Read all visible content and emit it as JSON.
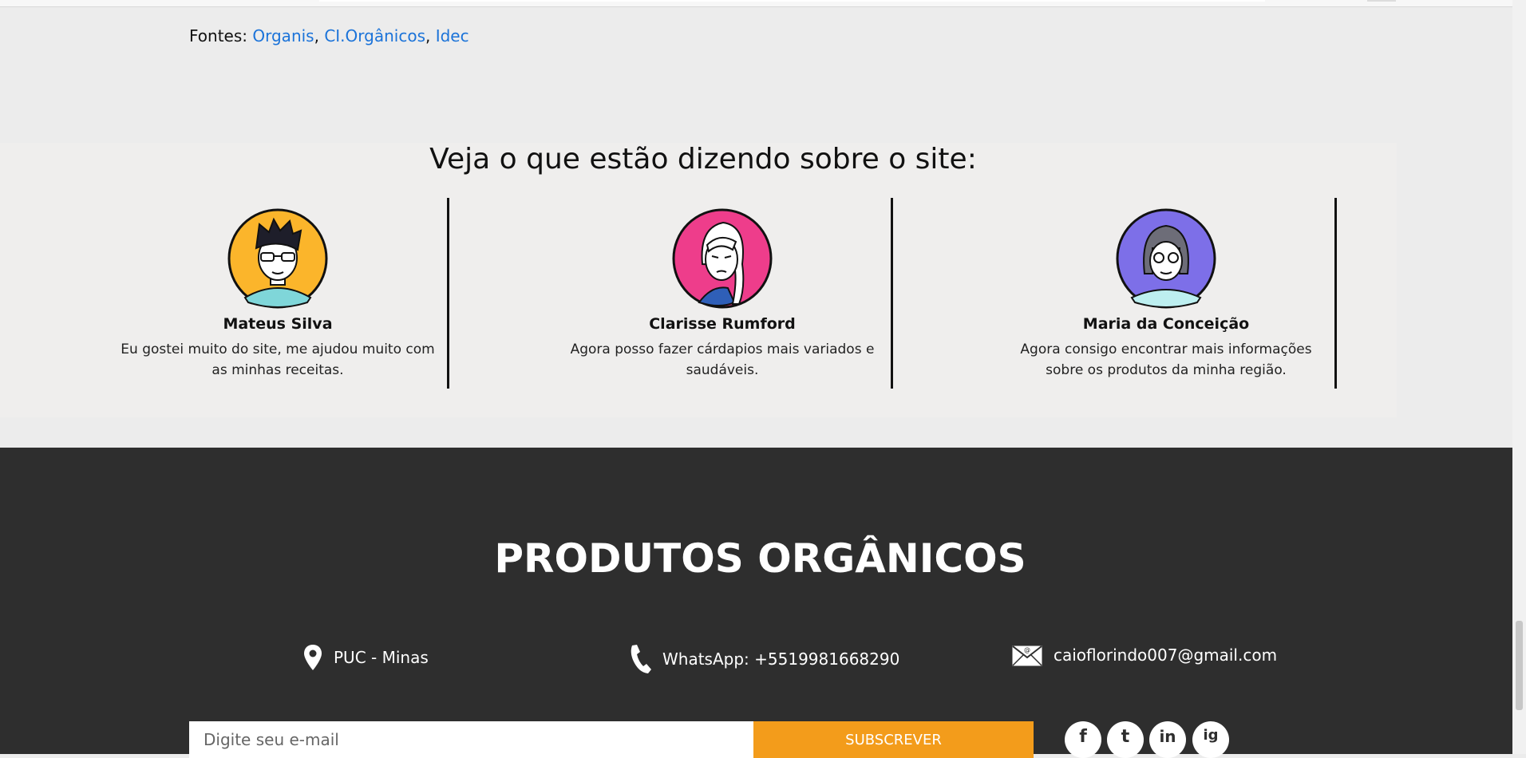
{
  "sources": {
    "label": "Fontes:",
    "links": [
      "Organis",
      "CI.Orgânicos",
      "Idec"
    ],
    "separator": ", "
  },
  "testimonials": {
    "heading": "Veja o que estão dizendo sobre o site:",
    "items": [
      {
        "name": "Mateus Silva",
        "quote": "Eu gostei muito do site, me ajudou muito com as minhas receitas.",
        "avatar_color": "#fbb52b"
      },
      {
        "name": "Clarisse Rumford",
        "quote": "Agora posso fazer cárdapios mais variados e saudáveis.",
        "avatar_color": "#ee3d8b"
      },
      {
        "name": "Maria da Conceição",
        "quote": "Agora consigo encontrar mais informações sobre os produtos da minha região.",
        "avatar_color": "#7d6fe8"
      }
    ]
  },
  "footer": {
    "brand": "PRODUTOS ORGÂNICOS",
    "location": {
      "icon": "location-pin-icon",
      "text": "PUC - Minas"
    },
    "phone": {
      "icon": "phone-icon",
      "text": "WhatsApp: +5519981668290"
    },
    "email": {
      "icon": "mail-icon",
      "text": "caioflorindo007@gmail.com"
    },
    "newsletter": {
      "placeholder": "Digite seu e-mail",
      "button": "SUBSCREVER"
    },
    "social": [
      {
        "icon": "facebook-icon",
        "glyph": "f"
      },
      {
        "icon": "twitter-icon",
        "glyph": "t"
      },
      {
        "icon": "linkedin-icon",
        "glyph": "in"
      },
      {
        "icon": "instagram-icon",
        "glyph": "ig"
      }
    ]
  },
  "colors": {
    "background": "#ececec",
    "link": "#1b73d9",
    "footer_bg": "#2e2e2e",
    "accent": "#f39c1b"
  }
}
